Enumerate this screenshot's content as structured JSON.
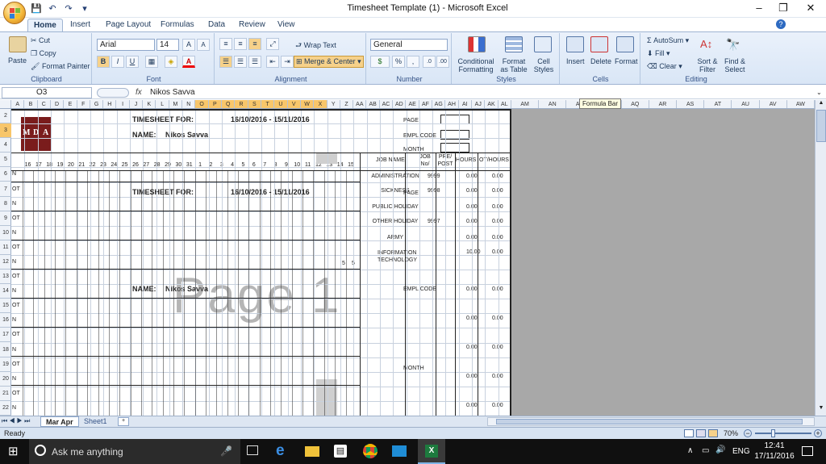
{
  "window": {
    "title": "Timesheet Template (1) - Microsoft Excel",
    "min": "–",
    "max": "❐",
    "close": "✕"
  },
  "qat": [
    "save-icon",
    "undo-icon",
    "redo-icon"
  ],
  "tabs": [
    "Home",
    "Insert",
    "Page Layout",
    "Formulas",
    "Data",
    "Review",
    "View"
  ],
  "ribbon": {
    "clipboard": {
      "paste": "Paste",
      "cut": "Cut",
      "copy": "Copy",
      "format_painter": "Format Painter",
      "label": "Clipboard"
    },
    "font": {
      "name": "Arial",
      "size": "14",
      "label": "Font",
      "bold": "B",
      "italic": "I",
      "underline": "U",
      "grow": "A",
      "shrink": "A",
      "color": "A"
    },
    "alignment": {
      "wrap": "Wrap Text",
      "merge": "Merge & Center",
      "label": "Alignment"
    },
    "number": {
      "format": "General",
      "percent": "%",
      "comma": ",",
      "currency": "$",
      "label": "Number"
    },
    "styles": {
      "conditional": "Conditional Formatting",
      "table": "Format as Table",
      "cell": "Cell Styles",
      "label": "Styles"
    },
    "cells": {
      "insert": "Insert",
      "delete": "Delete",
      "format": "Format",
      "label": "Cells"
    },
    "editing": {
      "autosum": "AutoSum",
      "fill": "Fill",
      "clear": "Clear",
      "sort": "Sort & Filter",
      "find": "Find & Select",
      "label": "Editing"
    }
  },
  "formula_bar": {
    "cell": "O3",
    "fx": "fx",
    "content": "Nikos Savva",
    "tooltip": "Formula Bar"
  },
  "columns_left": [
    "A",
    "B",
    "C",
    "D",
    "E",
    "F",
    "G",
    "H",
    "I",
    "J",
    "K",
    "L",
    "M",
    "N",
    "O",
    "P",
    "Q",
    "R",
    "S",
    "T",
    "U",
    "V",
    "W",
    "X",
    "Y",
    "Z",
    "AA",
    "AB",
    "AC",
    "AD",
    "AE",
    "AF",
    "AG",
    "AH",
    "AI",
    "AJ",
    "AK",
    "AL"
  ],
  "columns_right": [
    "AM",
    "AN",
    "AO",
    "AP",
    "AQ",
    "AR",
    "AS",
    "AT",
    "AU",
    "AV",
    "AW"
  ],
  "rows": [
    "2",
    "3",
    "4",
    "5",
    "6",
    "7",
    "8",
    "9",
    "10",
    "11",
    "12",
    "13",
    "14",
    "15",
    "16",
    "17",
    "18",
    "19",
    "20",
    "21",
    "22"
  ],
  "sheet": {
    "logo": [
      "M",
      "D",
      "A"
    ],
    "timesheet_for": "TIMESHEET FOR:",
    "period": "16/10/2016 - 15/11/2016",
    "name_label": "NAME:",
    "name_value": "Nikos Savva",
    "page": "PAGE",
    "empl_code": "EMPL CODE",
    "month": "MONTH",
    "days": [
      "16",
      "17",
      "18",
      "19",
      "20",
      "21",
      "22",
      "23",
      "24",
      "25",
      "26",
      "27",
      "28",
      "29",
      "30",
      "31",
      "1",
      "2",
      "3",
      "4",
      "5",
      "6",
      "7",
      "8",
      "9",
      "10",
      "11",
      "12",
      "13",
      "14",
      "15"
    ],
    "job_header": {
      "name": "JOB NAME",
      "no": "JOB No/",
      "prepost": "PRE/ POST",
      "hours": "HOURS",
      "ot": "OT/HOURS"
    },
    "row_labels": [
      "N",
      "OT",
      "N",
      "OT",
      "N",
      "OT",
      "N",
      "OT",
      "N",
      "OT",
      "N",
      "OT",
      "N",
      "OT",
      "N",
      "OT",
      "N"
    ],
    "jobs": [
      {
        "name": "ADMINISTRATION",
        "no": "9999",
        "hours": "0.00",
        "ot": "0.00"
      },
      {
        "name": "SICKNESS",
        "no": "9998",
        "hours": "0.00",
        "ot": "0.00"
      },
      {
        "name": "PUBLIC HOLIDAY",
        "no": "",
        "hours": "0.00",
        "ot": "0.00"
      },
      {
        "name": "OTHER HOLIDAY",
        "no": "9997",
        "hours": "0.00",
        "ot": "0.00"
      },
      {
        "name": "ARMY",
        "no": "",
        "hours": "0.00",
        "ot": "0.00"
      },
      {
        "name": "INFORMATION TECHNOLOGY",
        "no": "",
        "hours": "10.00",
        "ot": "0.00"
      }
    ],
    "five_a": "5",
    "five_b": "5",
    "more_totals": [
      {
        "hours": "0.00",
        "ot": "0.00"
      },
      {
        "hours": "0.00",
        "ot": "0.00"
      },
      {
        "hours": "0.00",
        "ot": "0.00"
      },
      {
        "hours": "0.00",
        "ot": "0.00"
      },
      {
        "hours": "0.00",
        "ot": "0.00"
      }
    ],
    "watermark": "Page 1"
  },
  "sheet_tabs": [
    "Mar Apr",
    "Sheet1"
  ],
  "status": {
    "ready": "Ready",
    "zoom": "70%"
  },
  "taskbar": {
    "search": "Ask me anything",
    "lang": "ENG",
    "time": "12:41",
    "date": "17/11/2016"
  }
}
